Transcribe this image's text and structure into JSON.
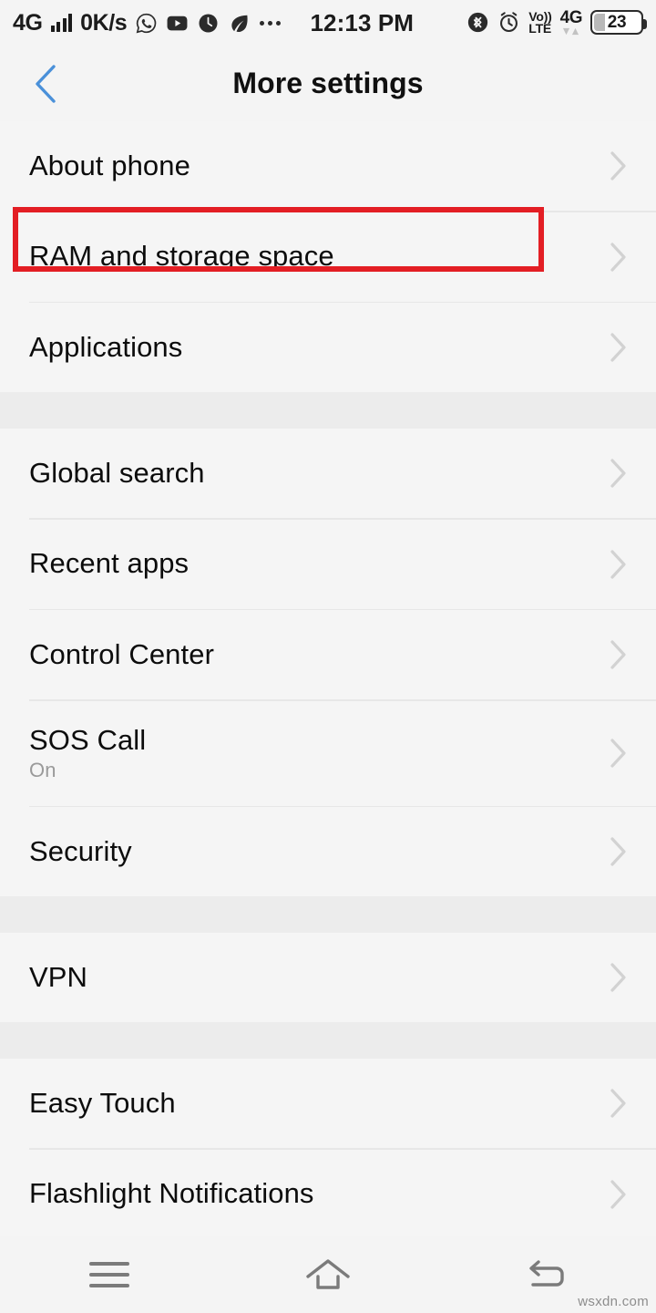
{
  "status_bar": {
    "network_type": "4G",
    "signal_icon": "signal-bars-icon",
    "data_rate": "0K/s",
    "notification_icons": [
      "whatsapp-icon",
      "youtube-icon",
      "clock-app-icon",
      "leaf-app-icon"
    ],
    "overflow_icon": "more-dots-icon",
    "time": "12:13 PM",
    "bluetooth_icon": "bluetooth-icon",
    "alarm_icon": "alarm-clock-icon",
    "volte_line1": "Vo))",
    "volte_line2": "LTE",
    "sim_network": "4G",
    "battery_percent": "23"
  },
  "header": {
    "back_icon": "back-chevron-icon",
    "title": "More settings",
    "accent_color": "#4a90d9"
  },
  "highlight": {
    "color": "#e31e24",
    "target": "RAM and storage space"
  },
  "sections": [
    {
      "id": "section-device",
      "items": [
        {
          "label": "About phone",
          "sub": null,
          "highlighted": false
        },
        {
          "label": "RAM and storage space",
          "sub": null,
          "highlighted": true
        },
        {
          "label": "Applications",
          "sub": null,
          "highlighted": false
        }
      ]
    },
    {
      "id": "section-system",
      "items": [
        {
          "label": "Global search",
          "sub": null,
          "highlighted": false
        },
        {
          "label": "Recent apps",
          "sub": null,
          "highlighted": false
        },
        {
          "label": "Control Center",
          "sub": null,
          "highlighted": false
        },
        {
          "label": "SOS Call",
          "sub": "On",
          "highlighted": false
        },
        {
          "label": "Security",
          "sub": null,
          "highlighted": false
        }
      ]
    },
    {
      "id": "section-network",
      "items": [
        {
          "label": "VPN",
          "sub": null,
          "highlighted": false
        }
      ]
    },
    {
      "id": "section-tools",
      "items": [
        {
          "label": "Easy Touch",
          "sub": null,
          "highlighted": false
        },
        {
          "label": "Flashlight Notifications",
          "sub": null,
          "highlighted": false
        }
      ]
    }
  ],
  "nav_bar": {
    "menu_icon": "menu-icon",
    "home_icon": "home-icon",
    "back_icon": "back-icon"
  },
  "watermark": "wsxdn.com"
}
